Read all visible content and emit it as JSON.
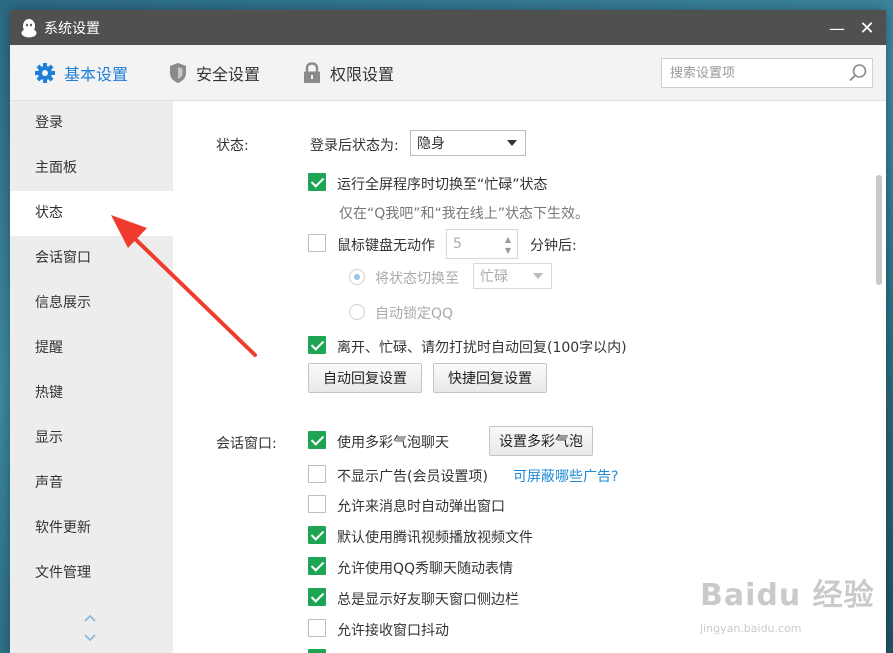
{
  "window": {
    "title": "系统设置",
    "minimize": "—",
    "close": "✕"
  },
  "topnav": {
    "tabs": [
      {
        "label": "基本设置",
        "icon": "gear-icon",
        "active": true
      },
      {
        "label": "安全设置",
        "icon": "shield-icon"
      },
      {
        "label": "权限设置",
        "icon": "lock-icon"
      }
    ],
    "search_placeholder": "搜索设置项"
  },
  "sidebar": {
    "items": [
      "登录",
      "主面板",
      "状态",
      "会话窗口",
      "信息展示",
      "提醒",
      "热键",
      "显示",
      "声音",
      "软件更新",
      "文件管理"
    ],
    "active": "状态"
  },
  "status": {
    "section_label": "状态:",
    "after_login_label": "登录后状态为:",
    "after_login_value": "隐身",
    "fullscreen_busy": "运行全屏程序时切换至“忙碌”状态",
    "fullscreen_hint": "仅在“Q我吧”和“我在线上”状态下生效。",
    "idle_label": "鼠标键盘无动作",
    "idle_minutes": "5",
    "idle_after": "分钟后:",
    "switch_to_label": "将状态切换至",
    "switch_to_value": "忙碌",
    "auto_lock": "自动锁定QQ",
    "auto_reply": "离开、忙碌、请勿打扰时自动回复(100字以内)",
    "auto_reply_btn": "自动回复设置",
    "quick_reply_btn": "快捷回复设置"
  },
  "chat": {
    "section_label": "会话窗口:",
    "colorful_bubble": "使用多彩气泡聊天",
    "colorful_bubble_btn": "设置多彩气泡",
    "no_ads": "不显示广告(会员设置项)",
    "no_ads_link": "可屏蔽哪些广告?",
    "auto_popup": "允许来消息时自动弹出窗口",
    "tencent_video": "默认使用腾讯视频播放视频文件",
    "qq_show": "允许使用QQ秀聊天随动表情",
    "sidebar_always": "总是显示好友聊天窗口侧边栏",
    "window_shake": "允许接收窗口抖动"
  },
  "watermark": {
    "brand": "Baidu 经验",
    "url": "jingyan.baidu.com"
  },
  "colors": {
    "accent": "#1e7fd9",
    "check_green": "#1ea554",
    "titlebar": "#505050",
    "annotation_arrow": "#f03c2e"
  }
}
